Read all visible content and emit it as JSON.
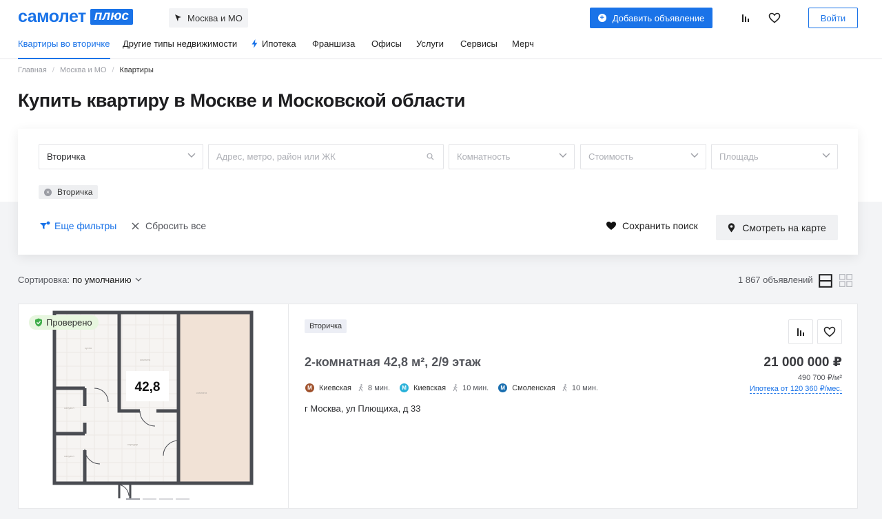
{
  "header": {
    "logo_word": "самолет",
    "logo_plus": "плюс",
    "region": "Москва и МО",
    "add_button": "Добавить объявление",
    "login_button": "Войти"
  },
  "nav": {
    "items": [
      {
        "label": "Квартиры во вторичке",
        "active": true
      },
      {
        "label": "Другие типы недвижимости"
      },
      {
        "label": "Ипотека",
        "icon": "lightning-icon"
      },
      {
        "label": "Франшиза"
      },
      {
        "label": "Офисы"
      },
      {
        "label": "Услуги"
      },
      {
        "label": "Сервисы"
      },
      {
        "label": "Мерч"
      }
    ]
  },
  "breadcrumbs": [
    "Главная",
    "Москва и МО",
    "Квартиры"
  ],
  "page_title": "Купить квартиру в Москве и Московской области",
  "filters": {
    "market_type": "Вторичка",
    "address_placeholder": "Адрес, метро, район или ЖК",
    "rooms_placeholder": "Комнатность",
    "price_placeholder": "Стоимость",
    "area_placeholder": "Площадь",
    "active_chip": "Вторичка",
    "more_filters": "Еще фильтры",
    "reset_all": "Сбросить все",
    "save_search": "Сохранить поиск",
    "show_on_map": "Смотреть на карте"
  },
  "sorting": {
    "label": "Сортировка:",
    "value": "по умолчанию"
  },
  "results_count": "1 867 объявлений",
  "listing": {
    "verified_badge": "Проверено",
    "plan_area_label": "42,8",
    "tag": "Вторичка",
    "title": "2-комнатная 42,8 м², 2/9 этаж",
    "price": "21 000 000 ₽",
    "price_per_m2": "490 700 ₽/м²",
    "mortgage": "Ипотека от 120 360 ₽/мес.",
    "metro": [
      {
        "station": "Киевская",
        "minutes": "8 мин.",
        "color": "#a0522d"
      },
      {
        "station": "Киевская",
        "minutes": "10 мин.",
        "color": "#29b1d9"
      },
      {
        "station": "Смоленская",
        "minutes": "10 мин.",
        "color": "#1a6fb0"
      }
    ],
    "address": "г Москва, ул Плющиха, д 33",
    "photo_page": 1,
    "photo_count": 4
  },
  "colors": {
    "accent": "#1a73e8",
    "verified_bg": "#e7f6df",
    "verified_icon": "#3fae49"
  }
}
